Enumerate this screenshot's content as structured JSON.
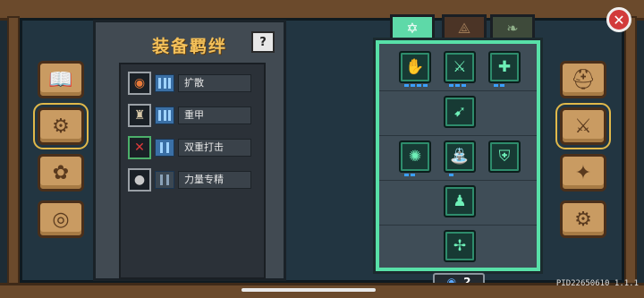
{
  "panel": {
    "title": "装备羁绊",
    "help_label": "?",
    "bonds": [
      {
        "name": "扩散",
        "icon": "orange-ring-icon",
        "active": true
      },
      {
        "name": "重甲",
        "icon": "armor-icon",
        "active": true
      },
      {
        "name": "双重打击",
        "icon": "crossed-slash-icon",
        "active": true
      },
      {
        "name": "力量专精",
        "icon": "fist-icon",
        "active": false
      }
    ]
  },
  "left_categories": [
    {
      "icon": "book-icon"
    },
    {
      "icon": "gears-icon",
      "active": true
    },
    {
      "icon": "paw-icon"
    },
    {
      "icon": "steering-wheel-icon"
    }
  ],
  "right_categories": [
    {
      "icon": "helmet-icon"
    },
    {
      "icon": "crossed-swords-icon",
      "active": true
    },
    {
      "icon": "star-burst-icon"
    },
    {
      "icon": "cog-icon"
    }
  ],
  "tabs": [
    {
      "icon": "hexagram-icon",
      "active": true
    },
    {
      "icon": "claw-icon",
      "active": false
    },
    {
      "icon": "leaf-icon",
      "active": false
    }
  ],
  "skills": [
    {
      "icon": "ghost-hand-icon"
    },
    {
      "icon": "slash-icon"
    },
    {
      "icon": "heal-cross-icon"
    },
    {
      "icon": "drill-icon"
    },
    {
      "icon": "gear-burst-icon"
    },
    {
      "icon": "fountain-icon"
    },
    {
      "icon": "shield-icon"
    },
    {
      "icon": "turret-icon"
    },
    {
      "icon": "fan-icon"
    }
  ],
  "currency": {
    "icon": "blue-gem-icon",
    "value": "2"
  },
  "close_label": "✕",
  "build_id": "PID22650610 1.1.1"
}
